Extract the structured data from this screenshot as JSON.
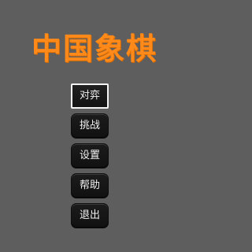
{
  "game": {
    "title": "中国象棋",
    "title_color": "#ff8a1a",
    "background_color": "#5e5e5e"
  },
  "menu": {
    "items": [
      {
        "label": "对弈",
        "selected": true
      },
      {
        "label": "挑战",
        "selected": false
      },
      {
        "label": "设置",
        "selected": false
      },
      {
        "label": "帮助",
        "selected": false
      },
      {
        "label": "退出",
        "selected": false
      }
    ]
  }
}
